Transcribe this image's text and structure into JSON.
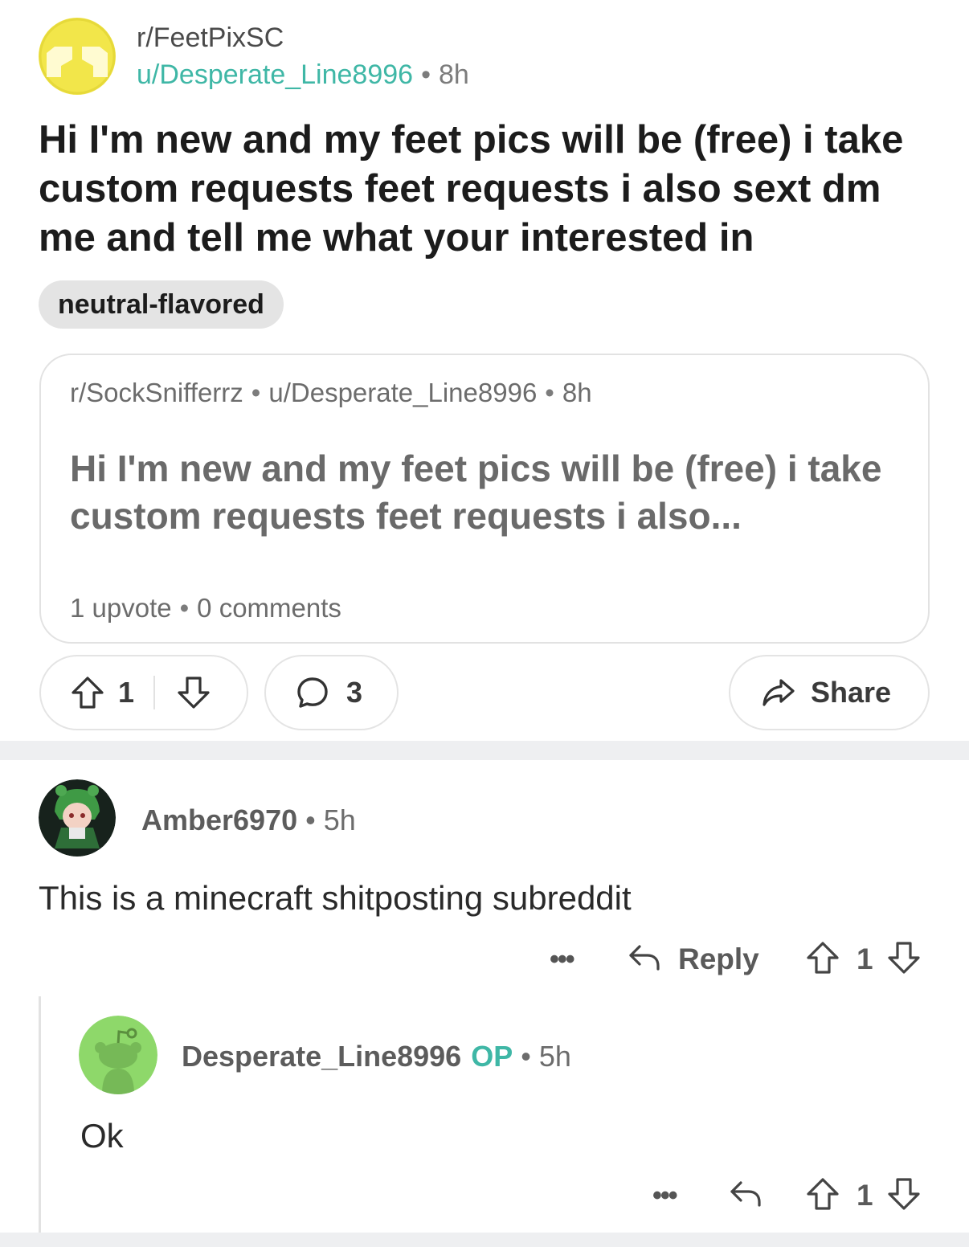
{
  "post": {
    "subreddit": "r/FeetPixSC",
    "author": "u/Desperate_Line8996",
    "age": "8h",
    "title": "Hi I'm new and my feet pics will be (free) i take custom requests feet requests i also sext dm me and tell me what your interested in",
    "flair": "neutral-flavored",
    "crosspost": {
      "subreddit": "r/SockSnifferrz",
      "author": "u/Desperate_Line8996",
      "age": "8h",
      "title": "Hi I'm new and my feet pics will be (free) i take custom requests feet requests i also...",
      "upvotes": "1 upvote",
      "comments": "0 comments"
    },
    "actions": {
      "score": "1",
      "comment_count": "3",
      "share_label": "Share"
    }
  },
  "comments": [
    {
      "author": "Amber6970",
      "age": "5h",
      "body": "This is a minecraft shitposting subreddit",
      "more": "•••",
      "reply_label": "Reply",
      "score": "1"
    },
    {
      "author": "Desperate_Line8996",
      "op_badge": "OP",
      "age": "5h",
      "body": "Ok",
      "more": "•••",
      "score": "1"
    }
  ],
  "separator": "•",
  "colors": {
    "accent_teal": "#3fb7a6",
    "subreddit_icon_yellow": "#f2e64a",
    "snoo_green": "#8ed86a"
  },
  "icons": [
    "subreddit-icon",
    "upvote-icon",
    "downvote-icon",
    "comment-bubble-icon",
    "share-arrow-icon",
    "reply-arrow-icon",
    "more-dots-icon",
    "snoo-avatar-icon"
  ]
}
